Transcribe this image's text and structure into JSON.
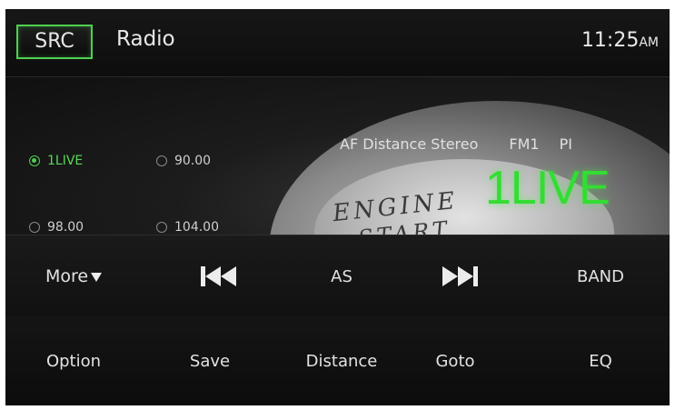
{
  "header": {
    "src_label": "SRC",
    "title": "Radio",
    "time": "11:25",
    "ampm": "AM"
  },
  "presets": [
    {
      "label": "1LIVE",
      "selected": true
    },
    {
      "label": "90.00",
      "selected": false
    },
    {
      "label": "98.00",
      "selected": false
    },
    {
      "label": "104.00",
      "selected": false
    }
  ],
  "status": {
    "flags": "AF Distance Stereo",
    "band": "FM1",
    "pi": "PI",
    "station": "1LIVE",
    "station_color": "#33dd33"
  },
  "background": {
    "engine_word_1": "ENGINE",
    "engine_word_2": "START"
  },
  "controls_row1": {
    "more": "More",
    "prev_icon": "skip-previous-icon",
    "as": "AS",
    "next_icon": "skip-next-icon",
    "band": "BAND"
  },
  "controls_row2": {
    "option": "Option",
    "save": "Save",
    "distance": "Distance",
    "goto": "Goto",
    "eq": "EQ"
  },
  "colors": {
    "accent": "#4fcf4f"
  }
}
